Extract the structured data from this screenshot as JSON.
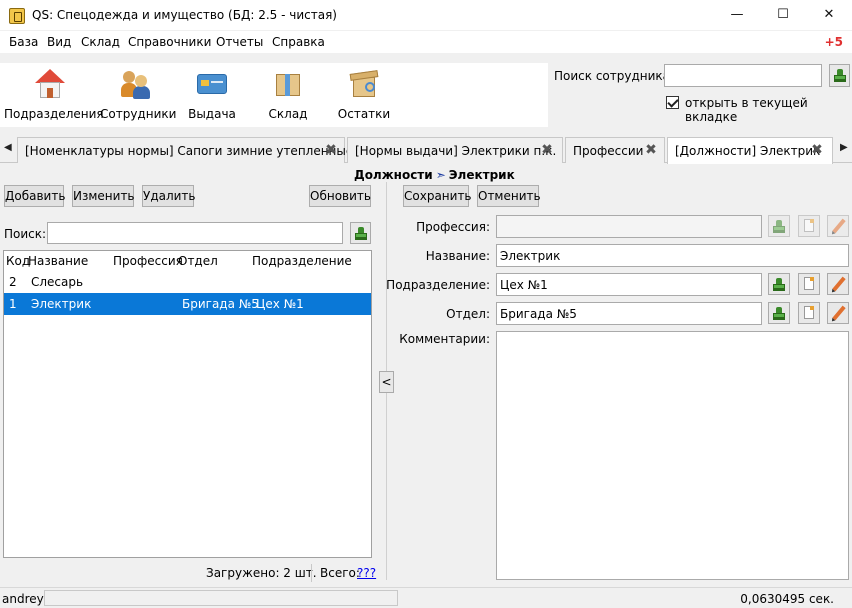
{
  "window": {
    "title": "QS: Спецодежда и имущество (БД: 2.5 - чистая)",
    "min_glyph": "—",
    "max_glyph": "☐",
    "close_glyph": "✕"
  },
  "menu": {
    "items": [
      "База",
      "Вид",
      "Склад",
      "Справочники",
      "Отчеты",
      "Справка"
    ],
    "extra": "+5"
  },
  "toolbar": {
    "buttons": [
      {
        "label": "Подразделения",
        "icon": "house-icon"
      },
      {
        "label": "Сотрудники",
        "icon": "people-icon"
      },
      {
        "label": "Выдача",
        "icon": "card-icon"
      },
      {
        "label": "Склад",
        "icon": "box-icon"
      },
      {
        "label": "Остатки",
        "icon": "stock-icon"
      }
    ]
  },
  "employee_search": {
    "label": "Поиск сотрудника:",
    "value": "",
    "open_in_current_tab_label": "открыть в текущей вкладке",
    "open_in_current_tab_checked": true
  },
  "tabs": {
    "scroll_left": "◀",
    "scroll_right": "▶",
    "close_glyph": "✖",
    "items": [
      {
        "label": "[Номенклатуры нормы] Сапоги зимние утепленные",
        "active": false
      },
      {
        "label": "[Нормы выдачи] Электрики п.к.",
        "active": false
      },
      {
        "label": "Профессии",
        "active": false
      },
      {
        "label": "[Должности] Электрик",
        "active": true
      }
    ]
  },
  "breadcrumb": {
    "parent": "Должности",
    "separator": "➣",
    "current": "Электрик"
  },
  "left_panel": {
    "add_label": "Добавить",
    "edit_label": "Изменить",
    "delete_label": "Удалить",
    "refresh_label": "Обновить",
    "search_label": "Поиск:",
    "search_value": "",
    "columns": [
      "Код",
      "Название",
      "Профессия",
      "Отдел",
      "Подразделение"
    ],
    "rows": [
      {
        "code": "2",
        "name": "Слесарь",
        "profession": "",
        "department": "",
        "subdivision": "",
        "selected": false
      },
      {
        "code": "1",
        "name": "Электрик",
        "profession": "",
        "department": "Бригада №5",
        "subdivision": "Цех №1",
        "selected": true
      }
    ],
    "loaded_text": "Загружено: 2 шт.",
    "total_label": "Всего:",
    "total_link": "???"
  },
  "splitter": {
    "collapse_glyph": "<"
  },
  "form": {
    "save_label": "Сохранить",
    "cancel_label": "Отменить",
    "profession_label": "Профессия:",
    "profession_value": "",
    "name_label": "Название:",
    "name_value": "Электрик",
    "subdivision_label": "Подразделение:",
    "subdivision_value": "Цех №1",
    "department_label": "Отдел:",
    "department_value": "Бригада №5",
    "comment_label": "Комментарии:",
    "comment_value": ""
  },
  "statusbar": {
    "user": "andrey",
    "message": "",
    "elapsed": "0,0630495 сек."
  },
  "colors": {
    "selection": "#0a78d7",
    "menu_extra": "#e03030",
    "link": "#0000ee"
  }
}
